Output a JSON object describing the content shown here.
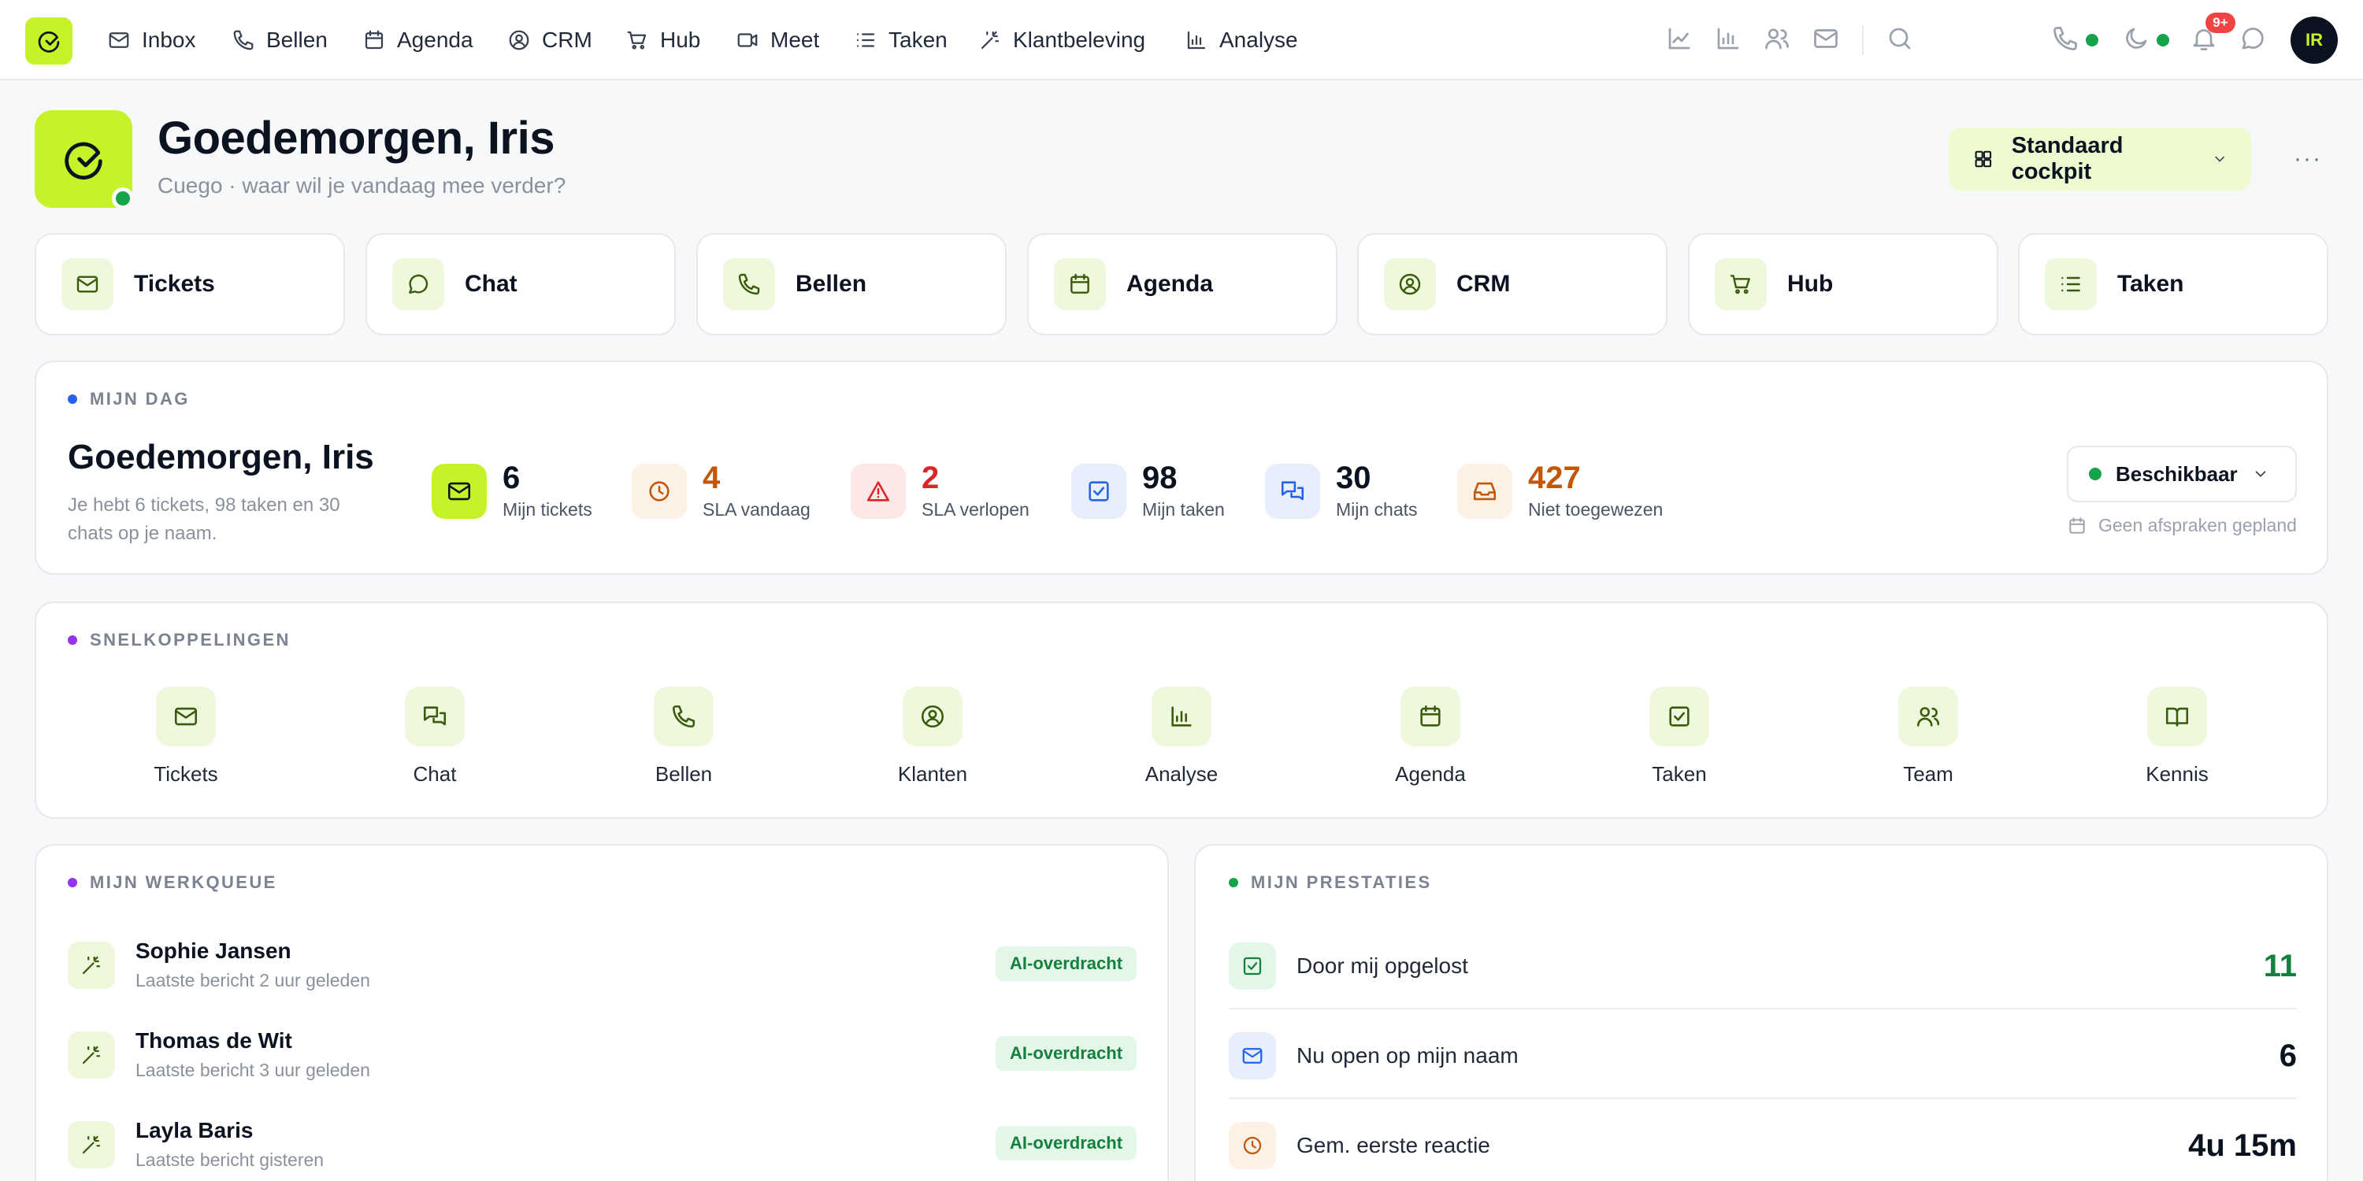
{
  "nav": {
    "items": [
      {
        "label": "Inbox",
        "icon": "mail-icon"
      },
      {
        "label": "Bellen",
        "icon": "phone-icon"
      },
      {
        "label": "Agenda",
        "icon": "calendar-icon"
      },
      {
        "label": "CRM",
        "icon": "user-circle-icon"
      },
      {
        "label": "Hub",
        "icon": "cart-icon"
      },
      {
        "label": "Meet",
        "icon": "video-icon"
      },
      {
        "label": "Taken",
        "icon": "list-icon"
      },
      {
        "label": "Klantbeleving",
        "icon": "wand-icon"
      },
      {
        "label": "Analyse",
        "icon": "bar-chart-icon"
      }
    ],
    "notification_count": "9+",
    "avatar_initials": "IR"
  },
  "header": {
    "title": "Goedemorgen, Iris",
    "subtitle": "Cuego · waar wil je vandaag mee verder?",
    "cockpit_label": "Standaard cockpit",
    "more_label": "···"
  },
  "modules": [
    {
      "label": "Tickets",
      "icon": "mail-icon"
    },
    {
      "label": "Chat",
      "icon": "chat-icon"
    },
    {
      "label": "Bellen",
      "icon": "phone-icon"
    },
    {
      "label": "Agenda",
      "icon": "calendar-icon"
    },
    {
      "label": "CRM",
      "icon": "user-circle-icon"
    },
    {
      "label": "Hub",
      "icon": "cart-icon"
    },
    {
      "label": "Taken",
      "icon": "list-icon"
    }
  ],
  "my_day": {
    "section_label": "MIJN DAG",
    "title": "Goedemorgen, Iris",
    "summary": "Je hebt 6 tickets, 98 taken en 30 chats op je naam.",
    "stats": [
      {
        "value": "6",
        "label": "Mijn tickets",
        "color": "#0b1220"
      },
      {
        "value": "4",
        "label": "SLA vandaag",
        "color": "#c2570c"
      },
      {
        "value": "2",
        "label": "SLA verlopen",
        "color": "#dc2626"
      },
      {
        "value": "98",
        "label": "Mijn taken",
        "color": "#0b1220"
      },
      {
        "value": "30",
        "label": "Mijn chats",
        "color": "#0b1220"
      },
      {
        "value": "427",
        "label": "Niet toegewezen",
        "color": "#c2570c"
      }
    ],
    "availability": "Beschikbaar",
    "no_appointments": "Geen afspraken gepland"
  },
  "shortcuts": {
    "section_label": "SNELKOPPELINGEN",
    "items": [
      {
        "label": "Tickets",
        "icon": "mail-icon"
      },
      {
        "label": "Chat",
        "icon": "chat-bubbles-icon"
      },
      {
        "label": "Bellen",
        "icon": "phone-icon"
      },
      {
        "label": "Klanten",
        "icon": "user-circle-icon"
      },
      {
        "label": "Analyse",
        "icon": "bar-chart-icon"
      },
      {
        "label": "Agenda",
        "icon": "calendar-icon"
      },
      {
        "label": "Taken",
        "icon": "check-square-icon"
      },
      {
        "label": "Team",
        "icon": "users-icon"
      },
      {
        "label": "Kennis",
        "icon": "book-icon"
      }
    ]
  },
  "work_queue": {
    "section_label": "MIJN WERKQUEUE",
    "rows": [
      {
        "name": "Sophie Jansen",
        "sub": "Laatste bericht 2 uur geleden",
        "badge": "AI-overdracht"
      },
      {
        "name": "Thomas de Wit",
        "sub": "Laatste bericht 3 uur geleden",
        "badge": "AI-overdracht"
      },
      {
        "name": "Layla Baris",
        "sub": "Laatste bericht gisteren",
        "badge": "AI-overdracht"
      }
    ]
  },
  "performance": {
    "section_label": "MIJN PRESTATIES",
    "rows": [
      {
        "label": "Door mij opgelost",
        "value": "11",
        "color": "#15803d"
      },
      {
        "label": "Nu open op mijn naam",
        "value": "6",
        "color": "#0b1220"
      },
      {
        "label": "Gem. eerste reactie",
        "value": "4u 15m",
        "color": "#0b1220"
      }
    ]
  },
  "colors": {
    "accent": "#c6f22a",
    "success": "#16a34a",
    "warning": "#c2570c",
    "danger": "#dc2626"
  }
}
